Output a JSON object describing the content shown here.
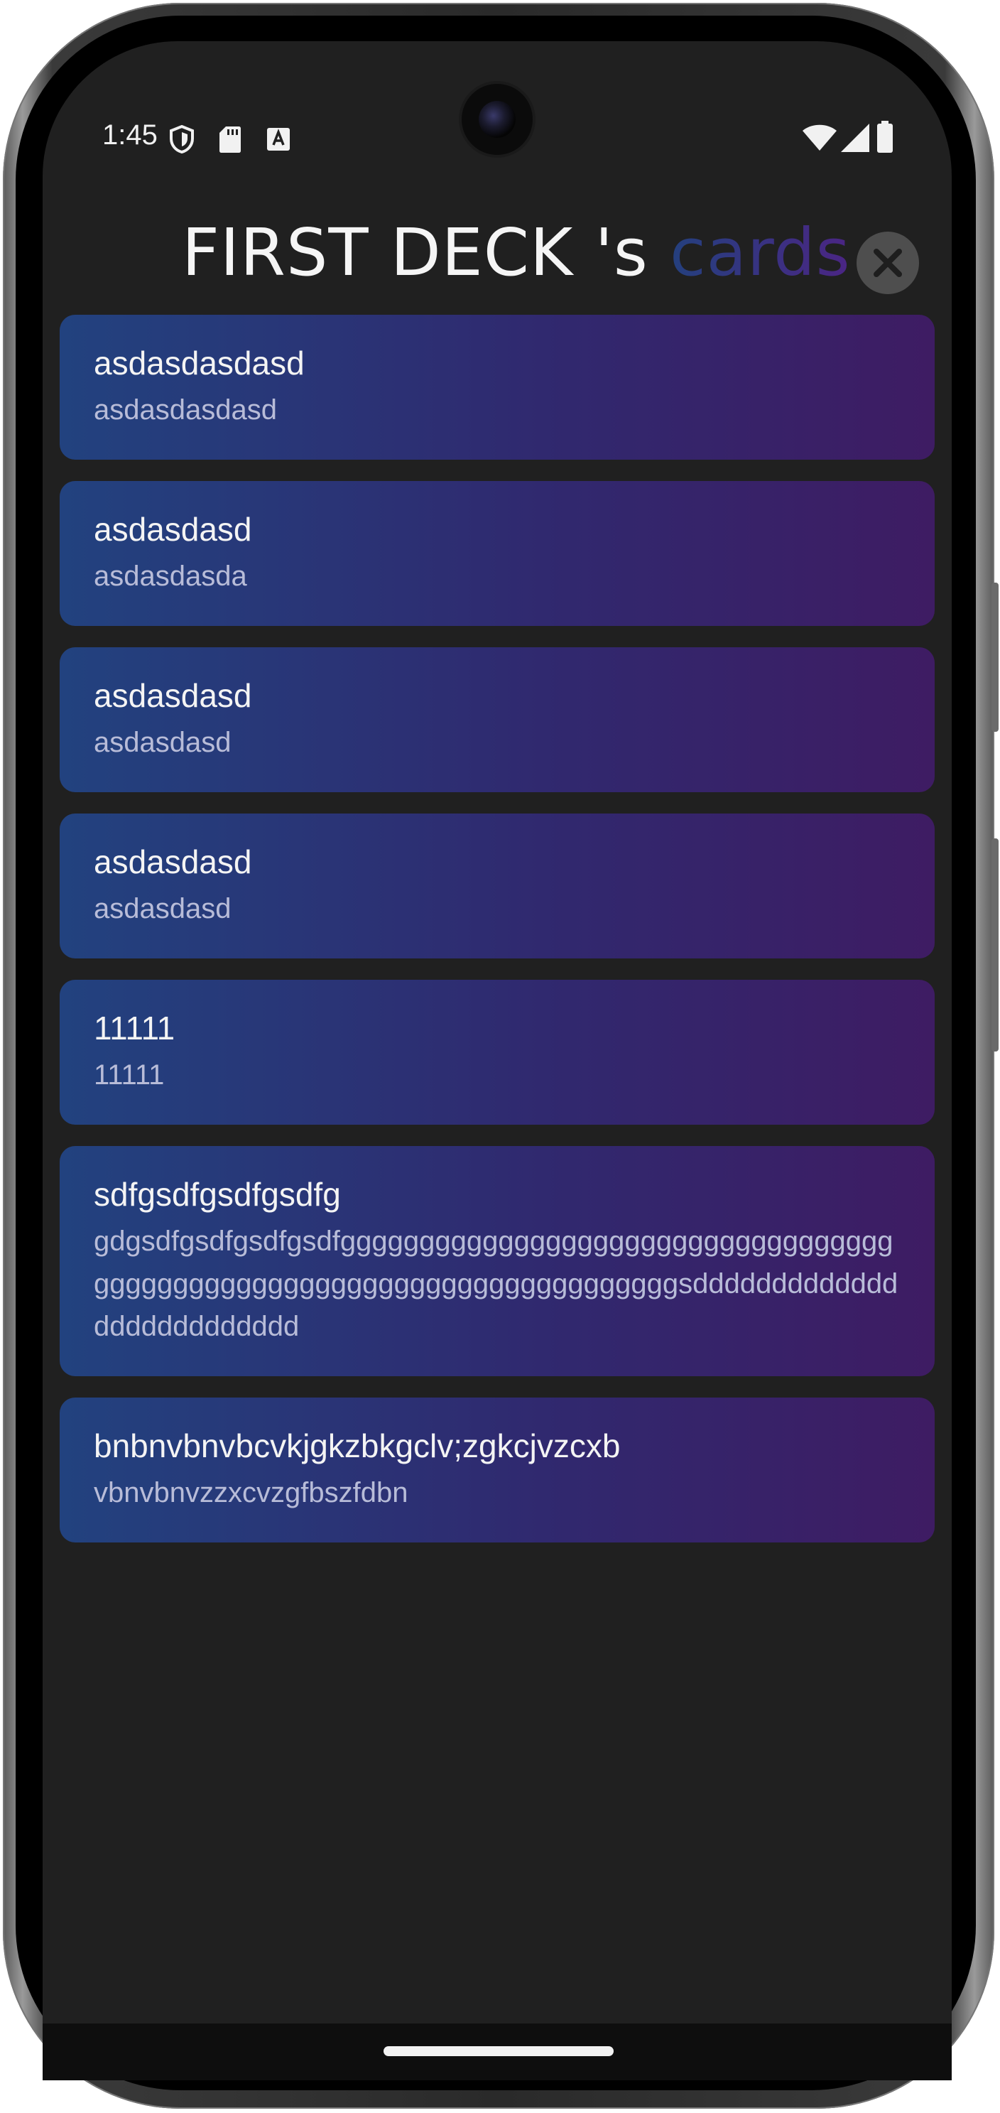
{
  "status_bar": {
    "time": "1:45",
    "icons": [
      "shield-icon",
      "sd-card-icon",
      "keyboard-a-icon",
      "wifi-icon",
      "cell-signal-icon",
      "battery-icon"
    ]
  },
  "header": {
    "title_prefix": "FIRST DECK 's ",
    "title_accent": "cards",
    "accent_gradient": [
      "#24407e",
      "#4b2584"
    ],
    "close_icon": "close-icon"
  },
  "cards": [
    {
      "front": "asdasdasdasd",
      "back": "asdasdasdasd"
    },
    {
      "front": "asdasdasd",
      "back": "asdasdasda"
    },
    {
      "front": "asdasdasd",
      "back": "asdasdasd"
    },
    {
      "front": "asdasdasd",
      "back": "asdasdasd"
    },
    {
      "front": "11111",
      "back": "11111"
    },
    {
      "front": "sdfgsdfgsdfgsdfg",
      "back": "gdgsdfgsdfgsdfgsdfggggggggggggggggggggggggggggggggggggggggggggggggggggggggggggggggggggggggsdddddddddddddddddddddddddd"
    },
    {
      "front": "bnbnvbnvbcvkjgkzbkgclv;zgkcjvzcxb",
      "back": "vbnvbnvzzxcvzgfbszfdbn"
    }
  ],
  "colors": {
    "screen_background": "#202020",
    "card_gradient_start": "#22427f",
    "card_gradient_end": "#3e1c63",
    "card_front_text": "#f4f4f4",
    "card_back_text": "#b8bcd8"
  }
}
